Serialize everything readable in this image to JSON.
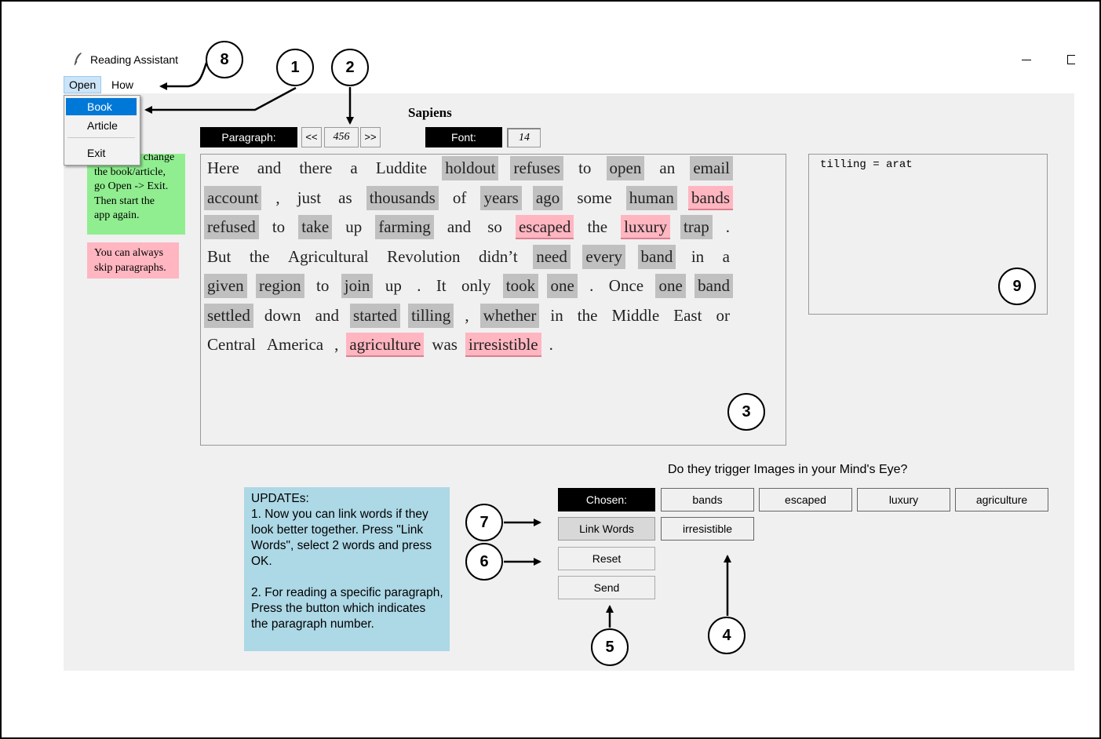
{
  "window": {
    "title": "Reading Assistant"
  },
  "menu": {
    "open": "Open",
    "how_to": "How to",
    "items": [
      "Book",
      "Article",
      "Exit"
    ]
  },
  "book_title": "Sapiens",
  "controls": {
    "paragraph_label": "Paragraph:",
    "prev": "<<",
    "paragraph_number": "456",
    "next": ">>",
    "font_label": "Font:",
    "font_size": "14"
  },
  "notes": {
    "change": [
      "In order to change",
      "the book/article,",
      "go Open -> Exit.",
      "Then start the",
      "app again."
    ],
    "skip": [
      "You can always",
      "skip paragraphs."
    ]
  },
  "text_lines": [
    [
      [
        "Here",
        "n"
      ],
      [
        "and",
        "n"
      ],
      [
        "there",
        "n"
      ],
      [
        "a",
        "n"
      ],
      [
        "Luddite",
        "n"
      ],
      [
        "holdout",
        "s"
      ],
      [
        "refuses",
        "s"
      ],
      [
        "to",
        "n"
      ],
      [
        "open",
        "s"
      ],
      [
        "an",
        "n"
      ],
      [
        "email",
        "s"
      ]
    ],
    [
      [
        "account",
        "s"
      ],
      [
        ",",
        "n"
      ],
      [
        "just",
        "n"
      ],
      [
        "as",
        "n"
      ],
      [
        "thousands",
        "s"
      ],
      [
        "of",
        "n"
      ],
      [
        "years",
        "s"
      ],
      [
        "ago",
        "s"
      ],
      [
        "some",
        "n"
      ],
      [
        "human",
        "s"
      ],
      [
        "bands",
        "p"
      ]
    ],
    [
      [
        "refused",
        "s"
      ],
      [
        "to",
        "n"
      ],
      [
        "take",
        "s"
      ],
      [
        "up",
        "n"
      ],
      [
        "farming",
        "s"
      ],
      [
        "and",
        "n"
      ],
      [
        "so",
        "n"
      ],
      [
        "escaped",
        "p"
      ],
      [
        "the",
        "n"
      ],
      [
        "luxury",
        "p"
      ],
      [
        "trap",
        "s"
      ],
      [
        ".",
        "n"
      ]
    ],
    [
      [
        "But",
        "n"
      ],
      [
        "the",
        "n"
      ],
      [
        "Agricultural",
        "n"
      ],
      [
        "Revolution",
        "n"
      ],
      [
        "didn’t",
        "n"
      ],
      [
        "need",
        "s"
      ],
      [
        "every",
        "s"
      ],
      [
        "band",
        "s"
      ],
      [
        "in",
        "n"
      ],
      [
        "a",
        "n"
      ]
    ],
    [
      [
        "given",
        "s"
      ],
      [
        "region",
        "s"
      ],
      [
        "to",
        "n"
      ],
      [
        "join",
        "s"
      ],
      [
        "up",
        "n"
      ],
      [
        ".",
        "n"
      ],
      [
        "It",
        "n"
      ],
      [
        "only",
        "n"
      ],
      [
        "took",
        "s"
      ],
      [
        "one",
        "s"
      ],
      [
        ".",
        "n"
      ],
      [
        "Once",
        "n"
      ],
      [
        "one",
        "s"
      ],
      [
        "band",
        "s"
      ]
    ],
    [
      [
        "settled",
        "s"
      ],
      [
        "down",
        "n"
      ],
      [
        "and",
        "n"
      ],
      [
        "started",
        "s"
      ],
      [
        "tilling",
        "s"
      ],
      [
        ",",
        "n"
      ],
      [
        "whether",
        "s"
      ],
      [
        "in",
        "n"
      ],
      [
        "the",
        "n"
      ],
      [
        "Middle",
        "n"
      ],
      [
        "East",
        "n"
      ],
      [
        "or",
        "n"
      ]
    ],
    [
      [
        "Central",
        "n"
      ],
      [
        "America",
        "n"
      ],
      [
        ",",
        "n"
      ],
      [
        "agriculture",
        "p"
      ],
      [
        "was",
        "n"
      ],
      [
        "irresistible",
        "p"
      ],
      [
        ".",
        "n"
      ]
    ]
  ],
  "dictionary_text": "tilling = arat",
  "question": "Do they trigger Images in your Mind's Eye?",
  "updates": [
    "UPDATEs:",
    "1. Now you can link words if they look better together. Press \"Link Words\", select 2 words and press OK.",
    "2. For reading a specific paragraph, Press the button which indicates the paragraph number."
  ],
  "buttons": {
    "chosen_label": "Chosen:",
    "link_words": "Link Words",
    "reset": "Reset",
    "send": "Send"
  },
  "chosen_words": [
    "bands",
    "escaped",
    "luxury",
    "agriculture",
    "irresistible"
  ],
  "callouts": [
    "1",
    "2",
    "3",
    "4",
    "5",
    "6",
    "7",
    "8",
    "9"
  ],
  "colors": {
    "selected_word": "#c0c0c0",
    "chosen_word": "#ffb6c1",
    "note_green": "#90ee90",
    "note_pink": "#ffb6c1",
    "updates_bg": "#add8e6",
    "menu_highlight": "#0078d7"
  }
}
